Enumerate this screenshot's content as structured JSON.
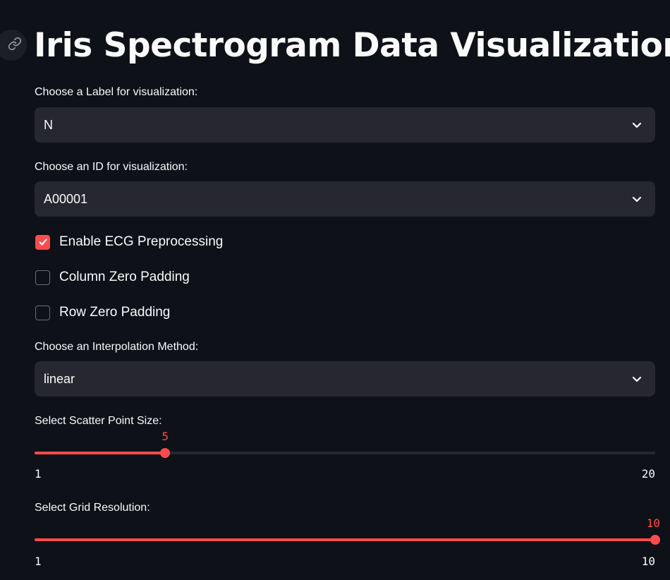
{
  "title": "Iris Spectrogram Data Visualization",
  "label_select": {
    "label": "Choose a Label for visualization:",
    "value": "N"
  },
  "id_select": {
    "label": "Choose an ID for visualization:",
    "value": "A00001"
  },
  "checkboxes": [
    {
      "label": "Enable ECG Preprocessing",
      "checked": true
    },
    {
      "label": "Column Zero Padding",
      "checked": false
    },
    {
      "label": "Row Zero Padding",
      "checked": false
    }
  ],
  "interp_select": {
    "label": "Choose an Interpolation Method:",
    "value": "linear"
  },
  "point_size_slider": {
    "label": "Select Scatter Point Size:",
    "value": 5,
    "min": 1,
    "max": 20
  },
  "grid_slider": {
    "label": "Select Grid Resolution:",
    "value": 10,
    "min": 1,
    "max": 10
  },
  "colors": {
    "accent": "#ff4b4b",
    "background": "#0e1117",
    "widget_bg": "#262730"
  }
}
